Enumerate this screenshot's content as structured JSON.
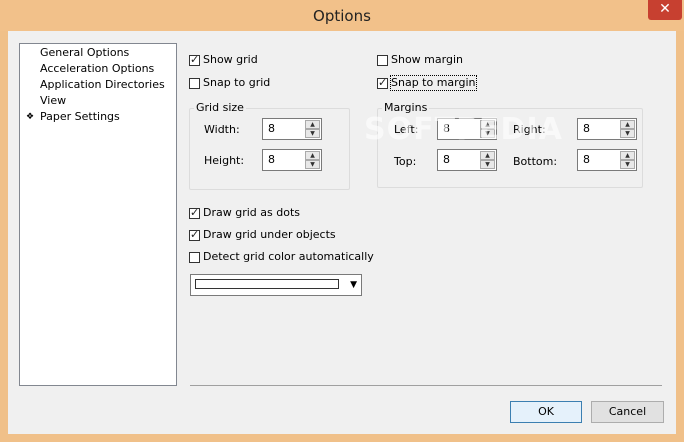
{
  "window": {
    "title": "Options",
    "close_glyph": "✕"
  },
  "nav": {
    "items": [
      {
        "label": "General Options",
        "selected": false
      },
      {
        "label": "Acceleration Options",
        "selected": false
      },
      {
        "label": "Application Directories",
        "selected": false
      },
      {
        "label": "View",
        "selected": false
      },
      {
        "label": "Paper Settings",
        "selected": true
      }
    ],
    "selected_marker": "❖"
  },
  "grid": {
    "show_grid": {
      "label": "Show grid",
      "checked": true
    },
    "snap_to_grid": {
      "label": "Snap to grid",
      "checked": false
    },
    "size_group": {
      "title": "Grid size",
      "width_label": "Width:",
      "width_value": "8",
      "height_label": "Height:",
      "height_value": "8"
    },
    "draw_as_dots": {
      "label": "Draw grid as dots",
      "checked": true
    },
    "draw_under_objects": {
      "label": "Draw grid under objects",
      "checked": true
    },
    "detect_color": {
      "label": "Detect grid color automatically",
      "checked": false
    },
    "color_combo": {
      "color": "#ffffff",
      "arrow_glyph": "▼"
    }
  },
  "margin": {
    "show_margin": {
      "label": "Show margin",
      "checked": false
    },
    "snap_to_margin": {
      "label": "Snap to margin",
      "checked": true
    },
    "margins_group": {
      "title": "Margins",
      "left_label": "Left:",
      "left_value": "8",
      "right_label": "Right:",
      "right_value": "8",
      "top_label": "Top:",
      "top_value": "8",
      "bottom_label": "Bottom:",
      "bottom_value": "8"
    }
  },
  "spin": {
    "up_glyph": "▲",
    "down_glyph": "▼"
  },
  "buttons": {
    "ok_label": "OK",
    "cancel_label": "Cancel"
  },
  "watermark": "SOFTPEDIA",
  "colors": {
    "frame": "#f0c089",
    "close": "#c74030",
    "client": "#f0f0f0"
  }
}
